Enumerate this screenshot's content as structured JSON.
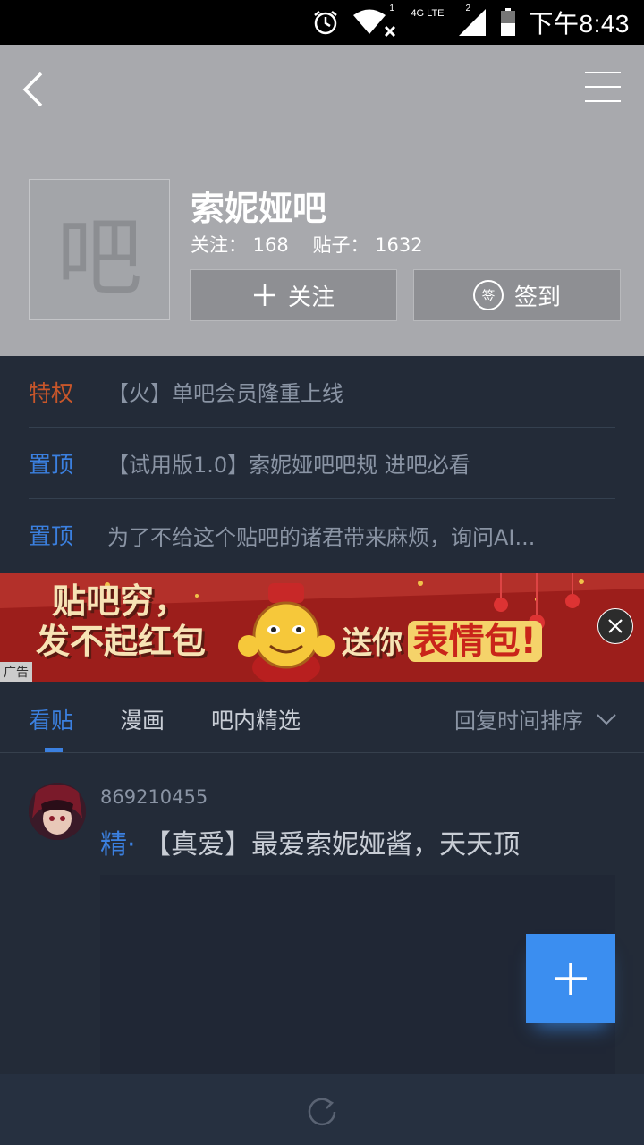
{
  "status_bar": {
    "time": "下午8:43",
    "network": "4G LTE",
    "sim1": "1",
    "sim2": "2"
  },
  "forum": {
    "avatar_char": "吧",
    "name": "索妮娅吧",
    "stats": "关注： 168    贴子： 1632",
    "follow_label": "关注",
    "signin_label": "签到",
    "signin_icon_char": "签"
  },
  "notices": [
    {
      "tag": "特权",
      "text": "【火】单吧会员隆重上线",
      "tag_color": "#c8562a"
    },
    {
      "tag": "置顶",
      "text": "【试用版1.0】索妮娅吧吧规  进吧必看",
      "tag_color": "#3b80e0"
    },
    {
      "tag": "置顶",
      "text": "为了不给这个贴吧的诸君带来麻烦，询问AI...",
      "tag_color": "#3b80e0"
    }
  ],
  "ad": {
    "line1": "贴吧穷，",
    "line2": "发不起红包",
    "line3": "送你",
    "line4": "表情包!",
    "label": "广告"
  },
  "tabs": {
    "t1": "看贴",
    "t2": "漫画",
    "t3": "吧内精选",
    "sort": "回复时间排序"
  },
  "post": {
    "user": "869210455",
    "badge": "精·",
    "title": "【真爱】最爱索妮娅酱，天天顶"
  },
  "colors": {
    "accent": "#3b80e0",
    "header_bg": "#a8a9ad",
    "page_bg": "#232b38",
    "privilege": "#c8562a"
  }
}
